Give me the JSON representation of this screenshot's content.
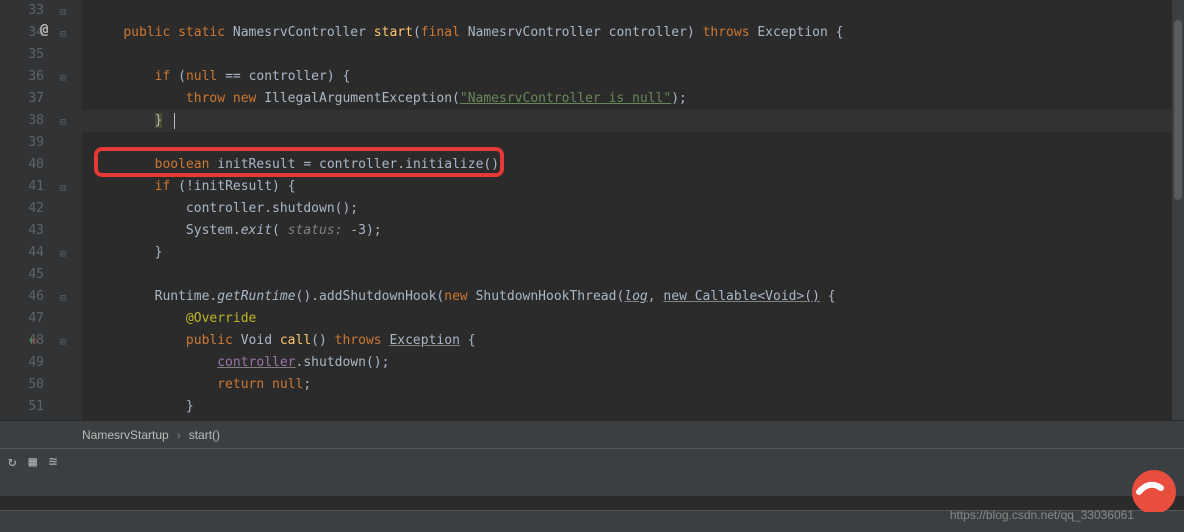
{
  "lineNumbers": [
    "33",
    "34",
    "35",
    "36",
    "37",
    "38",
    "39",
    "40",
    "41",
    "42",
    "43",
    "44",
    "45",
    "46",
    "47",
    "48",
    "49",
    "50",
    "51"
  ],
  "code": {
    "l34": {
      "kw1": "public",
      "kw2": "static",
      "cls": "NamesrvController",
      "method": "start",
      "paren": "(",
      "kw3": "final",
      "type": "NamesrvController",
      "var": "controller",
      "close": ") ",
      "kw4": "throws",
      "exc": "Exception",
      "brace": " {"
    },
    "l36": {
      "kw1": "if",
      "paren": " (",
      "kw2": "null",
      "op": " == ",
      "var": "controller",
      "close": ") {"
    },
    "l37": {
      "kw1": "throw",
      "kw2": "new",
      "cls": "IllegalArgumentException",
      "paren": "(",
      "str": "\"NamesrvController is null\"",
      "close": ");"
    },
    "l38": {
      "brace": "}"
    },
    "l40": {
      "kw1": "boolean",
      "var": "initResult",
      "op": " = ",
      "obj": "controller",
      "dot": ".",
      "method": "initialize",
      "close": "();"
    },
    "l41": {
      "kw1": "if",
      "paren": " (",
      "op": "!",
      "var": "initResult",
      "close": ") {"
    },
    "l42": {
      "obj": "controller",
      "dot": ".",
      "method": "shutdown",
      "close": "();"
    },
    "l43": {
      "cls": "System",
      "dot": ".",
      "method": "exit",
      "paren": "( ",
      "param": "status:",
      "val": " -3",
      "close": ");"
    },
    "l44": {
      "brace": "}"
    },
    "l46": {
      "cls": "Runtime",
      "dot": ".",
      "method1": "getRuntime",
      "mid": "().",
      "method2": "addShutdownHook",
      "paren": "(",
      "kw": "new",
      "cls2": "ShutdownHookThread",
      "paren2": "(",
      "p1": "log",
      "comma": ", ",
      "p2": "new Callable<Void>()",
      "close": " {"
    },
    "l47": {
      "ann": "@Override"
    },
    "l48": {
      "kw1": "public",
      "type": "Void",
      "method": "call",
      "paren": "() ",
      "kw2": "throws",
      "exc": "Exception",
      "brace": " {"
    },
    "l49": {
      "obj": "controller",
      "dot": ".",
      "method": "shutdown",
      "close": "();"
    },
    "l50": {
      "kw1": "return",
      "val": " null",
      "close": ";"
    },
    "l51": {
      "brace": "}"
    }
  },
  "breadcrumb": {
    "item1": "NamesrvStartup",
    "item2": "start()"
  },
  "watermark": "https://blog.csdn.net/qq_33036061",
  "gutterIcons": {
    "at": "@",
    "up": "↑"
  }
}
